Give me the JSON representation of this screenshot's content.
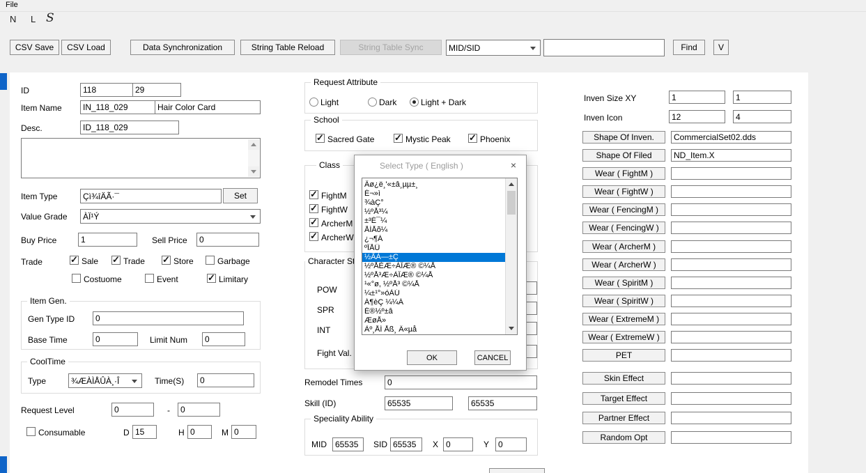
{
  "window": {
    "menu_file": "File",
    "format_letters": {
      "n": "N",
      "l": "L",
      "s": "S"
    }
  },
  "toolbar": {
    "csv_save": "CSV Save",
    "csv_load": "CSV Load",
    "data_synchronization": "Data Synchronization",
    "string_table_reload": "String Table Reload",
    "string_table_sync": "String Table Sync",
    "search_mode": "MID/SID",
    "search_text": "",
    "find": "Find",
    "v": "V"
  },
  "left": {
    "id_label": "ID",
    "id_1": "118",
    "id_2": "29",
    "item_name_label": "Item Name",
    "item_code": "IN_118_029",
    "item_name": "Hair Color Card",
    "desc_label": "Desc.",
    "desc_id": "ID_118_029",
    "desc_text": "",
    "item_type_label": "Item Type",
    "item_type": "Çì¾îÄÃ·¯",
    "set_btn": "Set",
    "value_grade_label": "Value Grade",
    "value_grade": "ÀÏ¹Ý",
    "buy_price_label": "Buy Price",
    "buy_price": "1",
    "sell_price_label": "Sell Price",
    "sell_price": "0",
    "trade_label": "Trade",
    "trade_options": [
      {
        "label": "Sale",
        "checked": true
      },
      {
        "label": "Trade",
        "checked": true
      },
      {
        "label": "Store",
        "checked": true
      },
      {
        "label": "Garbage",
        "checked": false
      },
      {
        "label": "Costuome",
        "checked": false
      },
      {
        "label": "Event",
        "checked": false
      },
      {
        "label": "Limitary",
        "checked": true
      }
    ],
    "item_gen": {
      "title": "Item Gen.",
      "gen_type_id_label": "Gen Type ID",
      "gen_type_id": "0",
      "base_time_label": "Base Time",
      "base_time": "0",
      "limit_num_label": "Limit Num",
      "limit_num": "0"
    },
    "cooltime": {
      "title": "CoolTime",
      "type_label": "Type",
      "type_value": "¾ÆÀÌÅÛÀ¸·Î",
      "time_label": "Time(S)",
      "time_value": "0"
    },
    "request_level_label": "Request Level",
    "request_level_min": "0",
    "request_level_sep": "-",
    "request_level_max": "0",
    "consumable": {
      "label": "Consumable",
      "checked": false
    },
    "d_label": "D",
    "d_value": "15",
    "h_label": "H",
    "h_value": "0",
    "m_label": "M",
    "m_value": "0"
  },
  "middle": {
    "request_attribute": {
      "title": "Request Attribute",
      "options": [
        {
          "label": "Light",
          "selected": false
        },
        {
          "label": "Dark",
          "selected": false
        },
        {
          "label": "Light + Dark",
          "selected": true
        }
      ]
    },
    "school": {
      "title": "School",
      "options": [
        {
          "label": "Sacred Gate",
          "checked": true
        },
        {
          "label": "Mystic Peak",
          "checked": true
        },
        {
          "label": "Phoenix",
          "checked": true
        }
      ]
    },
    "class": {
      "title": "Class",
      "options": [
        {
          "label": "FightM",
          "checked": true
        },
        {
          "label": "FightW",
          "checked": true
        },
        {
          "label": "ArcherM",
          "checked": true
        },
        {
          "label": "ArcherW",
          "checked": true
        }
      ]
    },
    "character_status": {
      "title": "Character Status",
      "pow_label": "POW",
      "pow": "",
      "spr_label": "SPR",
      "spr": "",
      "int_label": "INT",
      "int": "",
      "fight_val_label": "Fight Val.",
      "fight_val": ""
    },
    "remodel_times_label": "Remodel Times",
    "remodel_times": "0",
    "skill_id_label": "Skill (ID)",
    "skill_id_1": "65535",
    "skill_id_2": "65535",
    "speciality": {
      "title": "Speciality Ability",
      "mid_label": "MID",
      "mid": "65535",
      "sid_label": "SID",
      "sid": "65535",
      "x_label": "X",
      "x": "0",
      "y_label": "Y",
      "y": "0"
    }
  },
  "right": {
    "inven_size_label": "Inven Size XY",
    "inven_size_x": "1",
    "inven_size_y": "1",
    "inven_icon_label": "Inven Icon",
    "inven_icon_1": "12",
    "inven_icon_2": "4",
    "rows": [
      {
        "button": "Shape Of Inven.",
        "value": "CommercialSet02.dds"
      },
      {
        "button": "Shape Of Filed",
        "value": "ND_Item.X"
      },
      {
        "button": "Wear ( FightM )",
        "value": ""
      },
      {
        "button": "Wear ( FightW )",
        "value": ""
      },
      {
        "button": "Wear ( FencingM )",
        "value": ""
      },
      {
        "button": "Wear ( FencingW )",
        "value": ""
      },
      {
        "button": "Wear ( ArcherM )",
        "value": ""
      },
      {
        "button": "Wear ( ArcherW )",
        "value": ""
      },
      {
        "button": "Wear ( SpiritM )",
        "value": ""
      },
      {
        "button": "Wear ( SpiritW )",
        "value": ""
      },
      {
        "button": "Wear ( ExtremeM )",
        "value": ""
      },
      {
        "button": "Wear ( ExtremeW )",
        "value": ""
      },
      {
        "button": "PET",
        "value": ""
      },
      {
        "button": "Skin Effect",
        "value": ""
      },
      {
        "button": "Target Effect",
        "value": ""
      },
      {
        "button": "Partner Effect",
        "value": ""
      },
      {
        "button": "Random Opt",
        "value": ""
      }
    ]
  },
  "dialog": {
    "title": "Select Type ( English )",
    "items": [
      "Âø¿ë¸'«±â¸µµ±¸",
      "É¬»ì",
      "¾àÇ°",
      "½ºÅ³¼",
      "±³È¯¼",
      "ÅÍÅõ¼",
      "¿¬¶Á",
      "ºÎÅÛ",
      "½ÃÀ—±Ç",
      "½ºÅÈÆ÷ÀÎÆ® ©¼Å",
      "½ºÅ³Æ÷ÀÎÆ® ©¼Å",
      "¹«°ø, ½ºÅ³ ©¼Å",
      "¼±¹°»óÀÚ",
      "Á¶èÇ ¼¼Á",
      "É®½º±â",
      "ÆøÅ»",
      "Àº¸ÅÍ Åß¸ Ä«µå"
    ],
    "selected_index": 8,
    "ok": "OK",
    "cancel": "CANCEL"
  },
  "icons": {
    "close": "×"
  },
  "colors": {
    "selection": "#0078d7",
    "accent_mark": "#0f64c8",
    "panel": "#ffffff"
  }
}
